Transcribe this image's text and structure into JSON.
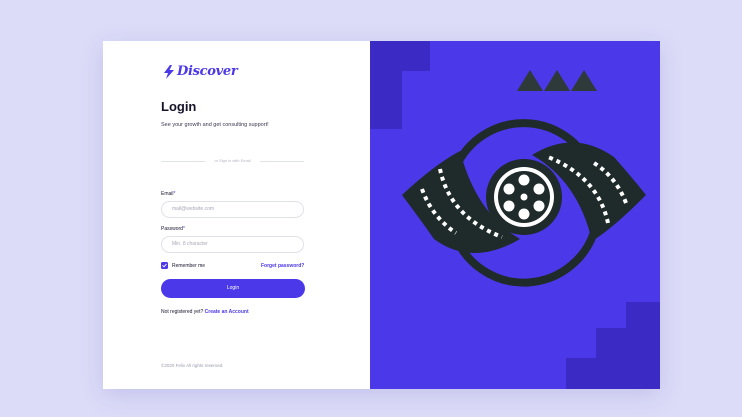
{
  "brand": {
    "name": "Discover"
  },
  "login": {
    "title": "Login",
    "subtitle": "See your growth and get consulting support!",
    "divider_text": "or Sign in with Email",
    "email": {
      "label": "Email",
      "required_mark": "*",
      "placeholder": "mail@website.com"
    },
    "password": {
      "label": "Password",
      "required_mark": "*",
      "placeholder": "Min. 8 character"
    },
    "remember_label": "Remember me",
    "remember_checked": true,
    "forgot_label": "Forget password?",
    "submit_label": "Login",
    "register_prompt": "Not registered yet?",
    "register_link": "Create an Account",
    "footer": "©2020 Felix All rights reserved."
  },
  "colors": {
    "accent": "#4b38e8",
    "accent_dark": "#3b2bc4",
    "page_bg": "#dcdcf8",
    "text_dark": "#16142b",
    "illustration_dark": "#1f2a2a"
  },
  "icons": {
    "logo": "lightning-bolt-icon",
    "checkbox": "check-icon",
    "illustration": "film-reel-eye-icon"
  }
}
